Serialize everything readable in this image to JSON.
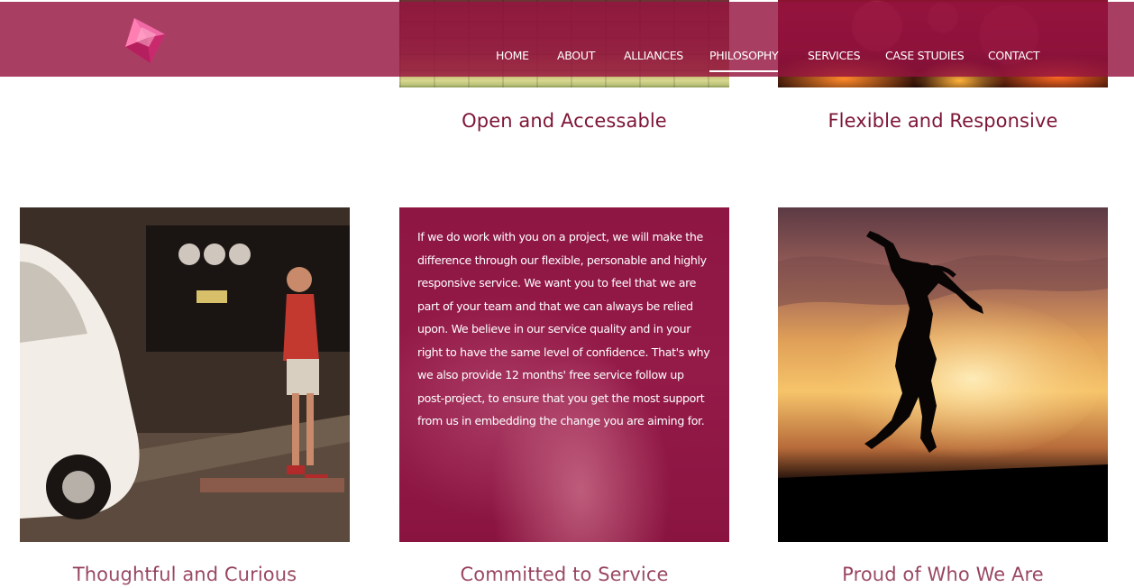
{
  "header": {
    "logo_name": "pink-gem-logo",
    "nav": [
      {
        "label": "HOME",
        "active": false
      },
      {
        "label": "ABOUT",
        "active": false
      },
      {
        "label": "ALLIANCES",
        "active": false
      },
      {
        "label": "PHILOSOPHY",
        "active": true
      },
      {
        "label": "SERVICES",
        "active": false
      },
      {
        "label": "CASE STUDIES",
        "active": false
      },
      {
        "label": "CONTACT",
        "active": false
      }
    ]
  },
  "values": [
    {
      "title": "Open and Accessable"
    },
    {
      "title": "Flexible and Responsive"
    },
    {
      "title": "Thoughtful and Curious"
    },
    {
      "title": "Committed to Service",
      "body": "If we do work with you on a project, we will make the difference through our flexible, personable and highly responsive service. We want you to feel that we are part of your team and that we can always be relied upon. We believe in our service quality and in your right to have the same level of confidence. That's why we also provide 12 months' free service follow up post-project, to ensure that you get the most support from us in embedding the change you are aiming for."
    },
    {
      "title": "Proud of Who We Are"
    }
  ],
  "colors": {
    "brand": "#961441",
    "title_text": "#7d1535",
    "nav_text": "#ffffff"
  }
}
